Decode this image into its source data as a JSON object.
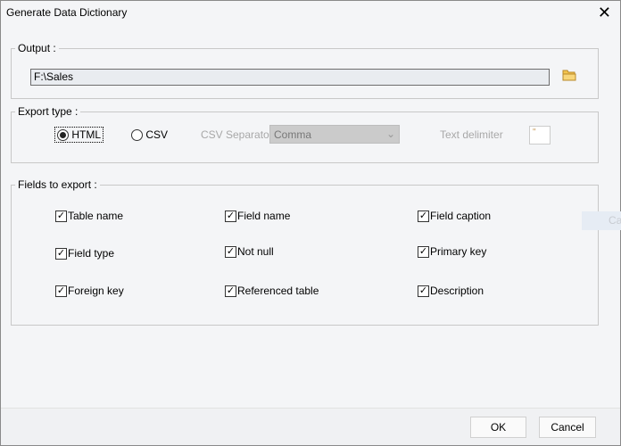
{
  "window": {
    "title": "Generate Data Dictionary",
    "close_icon": "close-icon"
  },
  "output": {
    "label": "Output :",
    "path": "F:\\Sales",
    "browse_icon": "folder-icon"
  },
  "export_type": {
    "label": "Export type :",
    "html_label": "HTML",
    "csv_label": "CSV",
    "selected": "HTML",
    "csv_separator_label": "CSV Separator",
    "csv_separator_value": "Comma",
    "text_delimiter_label": "Text delimiter",
    "text_delimiter_value": "\""
  },
  "fields": {
    "label": "Fields to export :",
    "items": [
      {
        "label": "Table name",
        "checked": true
      },
      {
        "label": "Field name",
        "checked": true
      },
      {
        "label": "Field caption",
        "checked": true
      },
      {
        "label": "Field type",
        "checked": true
      },
      {
        "label": "Not null",
        "checked": true
      },
      {
        "label": "Primary key",
        "checked": true
      },
      {
        "label": "Foreign key",
        "checked": true
      },
      {
        "label": "Referenced table",
        "checked": true
      },
      {
        "label": "Description",
        "checked": true
      }
    ]
  },
  "ghost_button": "Ca",
  "buttons": {
    "ok": "OK",
    "cancel": "Cancel"
  }
}
